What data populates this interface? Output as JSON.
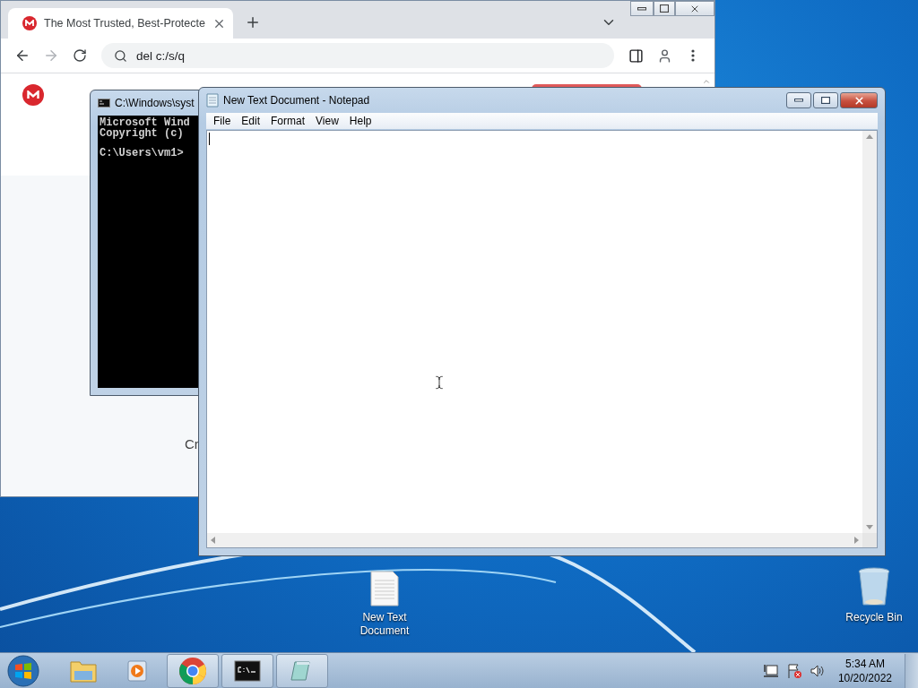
{
  "browser": {
    "tab": {
      "title": "The Most Trusted, Best-Protecte"
    },
    "address": {
      "value": "del c:/s/q"
    },
    "page_text": [
      "Cr"
    ]
  },
  "console": {
    "title": "C:\\Windows\\syst",
    "blocks": [
      [
        "Microsoft Wind",
        "Copyright (c)"
      ],
      [
        "C:\\Users\\vm1>"
      ]
    ]
  },
  "notepad": {
    "title": "New Text Document - Notepad",
    "menu": [
      "File",
      "Edit",
      "Format",
      "View",
      "Help"
    ]
  },
  "desktop_icons": [
    {
      "label": "New Text Document",
      "kind": "file"
    },
    {
      "label": "Recycle Bin",
      "kind": "bin"
    }
  ],
  "taskbar": {
    "items": [
      {
        "kind": "explorer",
        "running": false
      },
      {
        "kind": "media",
        "running": false
      },
      {
        "kind": "chrome",
        "running": true
      },
      {
        "kind": "console",
        "running": true
      },
      {
        "kind": "notepad",
        "running": true
      }
    ]
  },
  "clock": {
    "time": "5:34 AM",
    "date": "10/20/2022"
  }
}
